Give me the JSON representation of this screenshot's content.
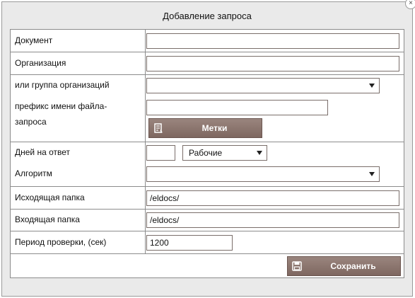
{
  "dialog": {
    "title": "Добавление запроса",
    "close_glyph": "×"
  },
  "fields": {
    "document_label": "Документ",
    "document_value": "",
    "organization_label": "Организация",
    "organization_value": "",
    "org_group_label": "или группа организаций",
    "org_group_value": "",
    "file_prefix_label_1": "префикс имени файла-",
    "file_prefix_label_2": "запроса",
    "file_prefix_value": "",
    "tags_button": "Метки",
    "days_label": "Дней на ответ",
    "days_value": "",
    "day_type_value": "Рабочие",
    "algorithm_label": "Алгоритм",
    "algorithm_value": "",
    "outgoing_label": "Исходящая папка",
    "outgoing_value": "/eldocs/",
    "incoming_label": "Входящая папка",
    "incoming_value": "/eldocs/",
    "period_label": "Период проверки, (сек)",
    "period_value": "1200"
  },
  "footer": {
    "save_button": "Сохранить"
  },
  "icons": {
    "tags_icon": "tag-list-icon",
    "save_icon": "floppy-disk-icon"
  },
  "colors": {
    "button_bg": "#8a746d",
    "border": "#8c8c8c"
  }
}
